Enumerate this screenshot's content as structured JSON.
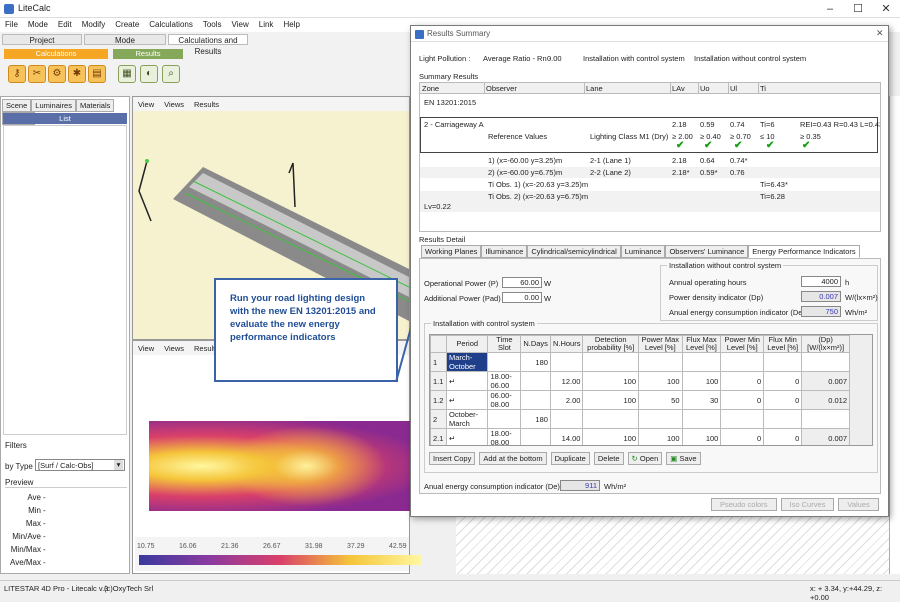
{
  "app": {
    "title": "LiteCalc",
    "menu": [
      "File",
      "Mode",
      "Edit",
      "Modify",
      "Create",
      "Calculations",
      "Tools",
      "View",
      "Link",
      "Help"
    ],
    "ribbon_tabs": [
      "Project",
      "Mode",
      "Calculations and Results"
    ],
    "ribbon_groups": {
      "calculations": "Calculations",
      "results": "Results"
    }
  },
  "left": {
    "tabs": [
      "Scene",
      "Luminaires",
      "Materials",
      "Results"
    ],
    "list_header": "List",
    "filters_label": "Filters",
    "by_type_label": "by Type",
    "by_type_value": "[Surf / Calc-Obs]",
    "preview_label": "Preview",
    "preview_rows": [
      "Ave",
      "Min",
      "Max",
      "Min/Ave",
      "Min/Max",
      "Ave/Max"
    ]
  },
  "viewport": {
    "top_tabs": [
      "View",
      "Views",
      "Results"
    ],
    "bottom_tabs": [
      "View",
      "Views",
      "Results"
    ],
    "scale": [
      "10.75",
      "16.06",
      "21.36",
      "26.67",
      "31.98",
      "37.29",
      "42.59"
    ]
  },
  "callout": "Run your road lighting design with the new EN 13201:2015 and evaluate the new energy performance indicators",
  "dialog": {
    "title": "Results Summary",
    "light_pollution_label": "Light Pollution :",
    "avg_ratio_label": "Average Ratio - Rn -",
    "avg_ratio_value": "0.00",
    "with_ctrl": "Installation with control system",
    "without_ctrl": "Installation without control system",
    "summary_label": "Summary Results",
    "cols": [
      "Zone",
      "Observer",
      "Lane",
      "LAv",
      "Uo",
      "Ul",
      "Ti"
    ],
    "norm": "EN 13201:2015",
    "zone": {
      "name": "2 - Carriageway A",
      "lav": "2.18",
      "uo": "0.59",
      "ul": "0.74",
      "ti": "Ti=6",
      "rei": "REI=0.43 R=0.43 L=0.43"
    },
    "ref": {
      "label": "Reference Values",
      "cls": "Lighting Class M1 (Dry)",
      "lav": "≥ 2.00",
      "uo": "≥ 0.40",
      "ul": "≥ 0.70",
      "ti": "≤ 10",
      "rei": "≥ 0.35"
    },
    "obs": [
      {
        "o": "1) (x=-60.00 y=3.25)m",
        "lane": "2-1 (Lane 1)",
        "lav": "2.18",
        "uo": "0.64",
        "ul": "0.74*",
        "ti": ""
      },
      {
        "o": "2) (x=-60.00 y=6.75)m",
        "lane": "2-2 (Lane 2)",
        "lav": "2.18*",
        "uo": "0.59*",
        "ul": "0.76",
        "ti": ""
      },
      {
        "o": "Ti Obs. 1) (x=-20.63 y=3.25)m",
        "lane": "",
        "lav": "",
        "uo": "",
        "ul": "",
        "ti": "Ti=6.43*"
      },
      {
        "o": "Ti Obs. 2) (x=-20.63 y=6.75)m",
        "lane": "",
        "lav": "",
        "uo": "",
        "ul": "",
        "ti": "Ti=6.28"
      }
    ],
    "lv": "Lv=0.22",
    "detail_label": "Results Detail",
    "detail_tabs": [
      "Working Planes",
      "Illuminance",
      "Cylindrical/semicylindrical",
      "Luminance",
      "Observers' Luminance",
      "Energy Performance Indicators"
    ],
    "op_power_label": "Operational Power (P)",
    "op_power": "60.00",
    "add_power_label": "Additional Power (Pad)",
    "add_power": "0.00",
    "unit_w": "W",
    "without": {
      "title": "Installation without control system",
      "hours_label": "Annual operating hours",
      "hours": "4000",
      "hours_unit": "h",
      "dp_label": "Power density indicator (Dp)",
      "dp": "0.007",
      "dp_unit": "W/(lx×m²)",
      "de_label": "Anual energy consumption indicator (De)",
      "de": "750",
      "de_unit": "Wh/m²"
    },
    "with": {
      "title": "Installation with control system",
      "headers": [
        "Period",
        "Time Slot",
        "N.Days",
        "N.Hours",
        "Detection probability [%]",
        "Power Max Level [%]",
        "Flux Max Level [%]",
        "Power Min Level [%]",
        "Flux Min Level [%]",
        "(Dp) [W/(lx×m²)]"
      ],
      "rows": [
        {
          "id": "1",
          "period": "March-October",
          "slot": "",
          "days": "180",
          "hours": "",
          "det": "",
          "pmax": "",
          "fmax": "",
          "pmin": "",
          "fmin": "",
          "dp": ""
        },
        {
          "id": "1.1",
          "period": "↵",
          "slot": "18.00-06.00",
          "days": "",
          "hours": "12.00",
          "det": "100",
          "pmax": "100",
          "fmax": "100",
          "pmin": "0",
          "fmin": "0",
          "dp": "0.007"
        },
        {
          "id": "1.2",
          "period": "↵",
          "slot": "06.00-08.00",
          "days": "",
          "hours": "2.00",
          "det": "100",
          "pmax": "50",
          "fmax": "30",
          "pmin": "0",
          "fmin": "0",
          "dp": "0.012"
        },
        {
          "id": "2",
          "period": "October-March",
          "slot": "",
          "days": "180",
          "hours": "",
          "det": "",
          "pmax": "",
          "fmax": "",
          "pmin": "",
          "fmin": "",
          "dp": ""
        },
        {
          "id": "2.1",
          "period": "↵",
          "slot": "18.00-08.00",
          "days": "",
          "hours": "14.00",
          "det": "100",
          "pmax": "100",
          "fmax": "100",
          "pmin": "0",
          "fmin": "0",
          "dp": "0.007"
        }
      ],
      "buttons": [
        "Insert Copy",
        "Add at the bottom",
        "Duplicate",
        "Delete",
        "Open",
        "Save"
      ],
      "de_label": "Anual energy consumption indicator (De)",
      "de": "911",
      "de_unit": "Wh/m²"
    },
    "footer_buttons": [
      "Pseudo colors",
      "Iso Curves",
      "Values"
    ]
  },
  "status": {
    "left": "LITESTAR 4D Pro - Litecalc v.3",
    "mid": "(c)OxyTech Srl",
    "right": "x: + 3.34, y:+44.29, z: +0.00"
  }
}
